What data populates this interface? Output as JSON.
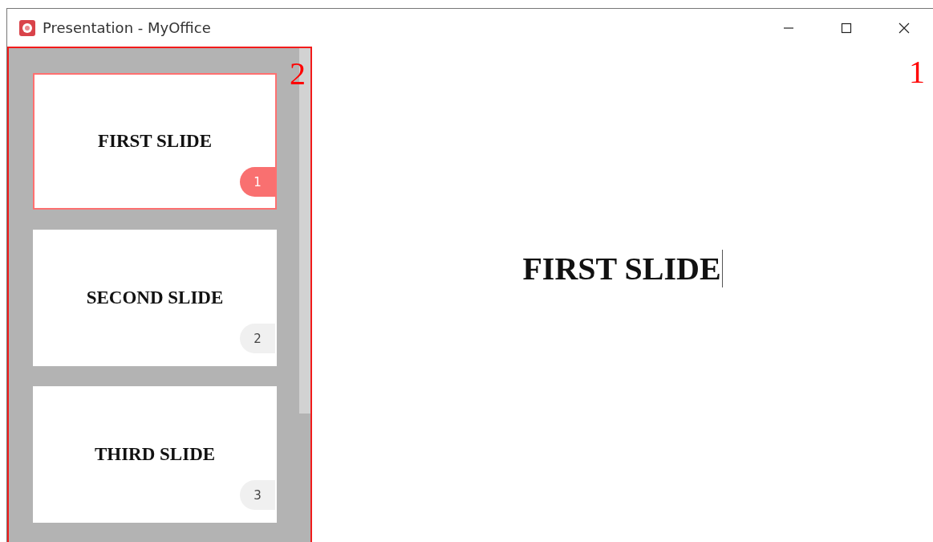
{
  "window": {
    "title": "Presentation - MyOffice"
  },
  "slides_panel": {
    "callout": "2"
  },
  "slides": [
    {
      "title": "FIRST SLIDE",
      "number": "1",
      "selected": true
    },
    {
      "title": "SECOND SLIDE",
      "number": "2",
      "selected": false
    },
    {
      "title": "THIRD SLIDE",
      "number": "3",
      "selected": false
    }
  ],
  "editor": {
    "title": "FIRST SLIDE",
    "callout": "1"
  }
}
